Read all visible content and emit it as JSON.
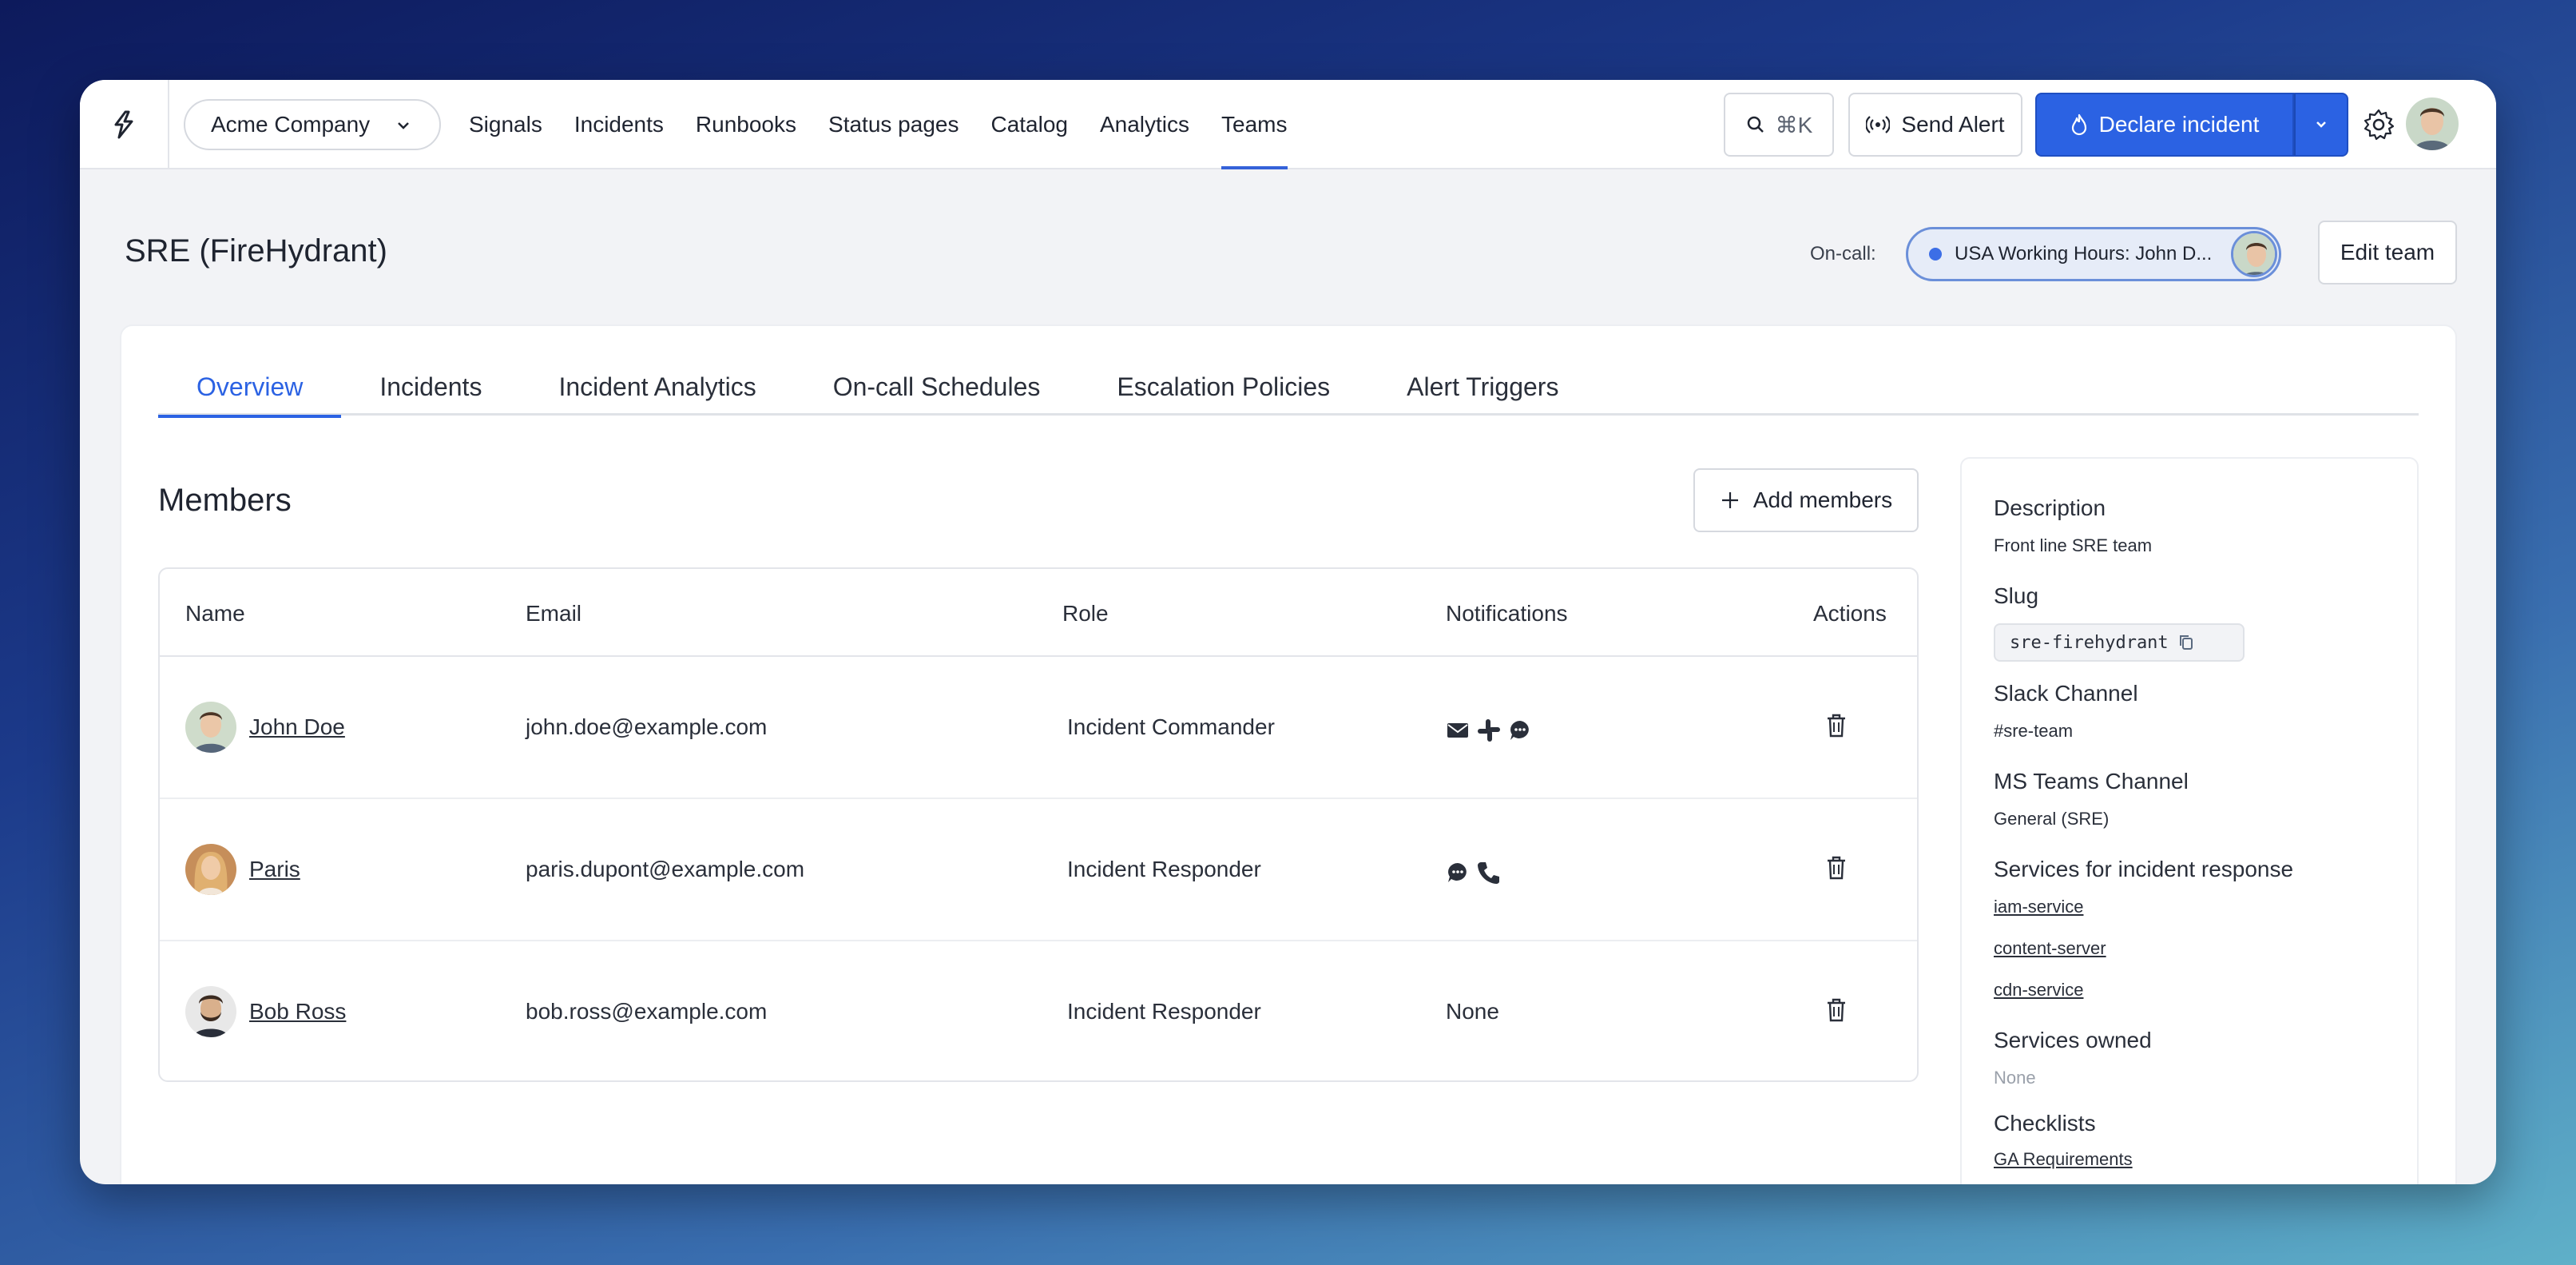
{
  "nav": {
    "org": "Acme Company",
    "links": [
      "Signals",
      "Incidents",
      "Runbooks",
      "Status pages",
      "Catalog",
      "Analytics",
      "Teams"
    ],
    "active_link": "Teams",
    "search_label": "⌘K",
    "send_alert": "Send Alert",
    "declare_incident": "Declare incident"
  },
  "header": {
    "team_name": "SRE (FireHydrant)",
    "oncall_label": "On-call:",
    "oncall_value": "USA Working Hours: John D...",
    "edit_team": "Edit team"
  },
  "tabs": [
    "Overview",
    "Incidents",
    "Incident Analytics",
    "On-call Schedules",
    "Escalation Policies",
    "Alert Triggers"
  ],
  "active_tab": "Overview",
  "members": {
    "title": "Members",
    "add_button": "Add members",
    "columns": [
      "Name",
      "Email",
      "Role",
      "Notifications",
      "Actions"
    ],
    "rows": [
      {
        "name": "John Doe",
        "email": "john.doe@example.com",
        "role": "Incident Commander",
        "notifications": [
          "email-icon",
          "slack-icon",
          "chat-icon"
        ],
        "notif_text": ""
      },
      {
        "name": "Paris",
        "email": "paris.dupont@example.com",
        "role": "Incident Responder",
        "notifications": [
          "chat-icon",
          "phone-icon"
        ],
        "notif_text": ""
      },
      {
        "name": "Bob Ross",
        "email": "bob.ross@example.com",
        "role": "Incident Responder",
        "notifications": [],
        "notif_text": "None"
      }
    ]
  },
  "sidebar": {
    "description_label": "Description",
    "description_value": "Front line SRE team",
    "slug_label": "Slug",
    "slug_value": "sre-firehydrant",
    "slack_label": "Slack Channel",
    "slack_value": "#sre-team",
    "msteams_label": "MS Teams Channel",
    "msteams_value": "General (SRE)",
    "services_response_label": "Services for incident response",
    "services_response": [
      "iam-service",
      "content-server",
      "cdn-service"
    ],
    "services_owned_label": "Services owned",
    "services_owned_value": "None",
    "checklists_label": "Checklists",
    "checklists": [
      "GA Requirements"
    ]
  },
  "colors": {
    "accent": "#2b62e3",
    "oncall_bg": "#e6ecf8"
  }
}
